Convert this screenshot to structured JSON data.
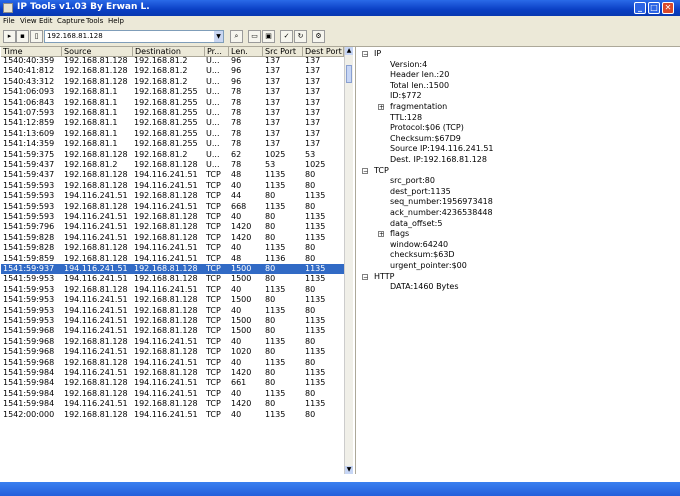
{
  "window": {
    "title": "IP Tools v1.03 By Erwan L."
  },
  "menu": [
    "File",
    "View",
    "Edit",
    "Capture",
    "Tools",
    "Help"
  ],
  "toolbar": {
    "address": "192.168.81.128"
  },
  "columns": [
    "Time",
    "Source",
    "Destination",
    "Pr...",
    "Len.",
    "Src Port",
    "Dest Port"
  ],
  "packets": [
    [
      "1540:40:359",
      "192.168.81.128",
      "192.168.81.2",
      "U...",
      "96",
      "137",
      "137"
    ],
    [
      "1540:41:812",
      "192.168.81.128",
      "192.168.81.2",
      "U...",
      "96",
      "137",
      "137"
    ],
    [
      "1540:43:312",
      "192.168.81.128",
      "192.168.81.2",
      "U...",
      "96",
      "137",
      "137"
    ],
    [
      "1541:06:093",
      "192.168.81.1",
      "192.168.81.255",
      "U...",
      "78",
      "137",
      "137"
    ],
    [
      "1541:06:843",
      "192.168.81.1",
      "192.168.81.255",
      "U...",
      "78",
      "137",
      "137"
    ],
    [
      "1541:07:593",
      "192.168.81.1",
      "192.168.81.255",
      "U...",
      "78",
      "137",
      "137"
    ],
    [
      "1541:12:859",
      "192.168.81.1",
      "192.168.81.255",
      "U...",
      "78",
      "137",
      "137"
    ],
    [
      "1541:13:609",
      "192.168.81.1",
      "192.168.81.255",
      "U...",
      "78",
      "137",
      "137"
    ],
    [
      "1541:14:359",
      "192.168.81.1",
      "192.168.81.255",
      "U...",
      "78",
      "137",
      "137"
    ],
    [
      "1541:59:375",
      "192.168.81.128",
      "192.168.81.2",
      "U...",
      "62",
      "1025",
      "53"
    ],
    [
      "1541:59:437",
      "192.168.81.2",
      "192.168.81.128",
      "U...",
      "78",
      "53",
      "1025"
    ],
    [
      "1541:59:437",
      "192.168.81.128",
      "194.116.241.51",
      "TCP",
      "48",
      "1135",
      "80"
    ],
    [
      "1541:59:593",
      "192.168.81.128",
      "194.116.241.51",
      "TCP",
      "40",
      "1135",
      "80"
    ],
    [
      "1541:59:593",
      "194.116.241.51",
      "192.168.81.128",
      "TCP",
      "44",
      "80",
      "1135"
    ],
    [
      "1541:59:593",
      "192.168.81.128",
      "194.116.241.51",
      "TCP",
      "668",
      "1135",
      "80"
    ],
    [
      "1541:59:593",
      "194.116.241.51",
      "192.168.81.128",
      "TCP",
      "40",
      "80",
      "1135"
    ],
    [
      "1541:59:796",
      "194.116.241.51",
      "192.168.81.128",
      "TCP",
      "1420",
      "80",
      "1135"
    ],
    [
      "1541:59:828",
      "194.116.241.51",
      "192.168.81.128",
      "TCP",
      "1420",
      "80",
      "1135"
    ],
    [
      "1541:59:828",
      "192.168.81.128",
      "194.116.241.51",
      "TCP",
      "40",
      "1135",
      "80"
    ],
    [
      "1541:59:859",
      "192.168.81.128",
      "194.116.241.51",
      "TCP",
      "48",
      "1136",
      "80"
    ],
    [
      "1541:59:937",
      "194.116.241.51",
      "192.168.81.128",
      "TCP",
      "1500",
      "80",
      "1135"
    ],
    [
      "1541:59:953",
      "194.116.241.51",
      "192.168.81.128",
      "TCP",
      "1500",
      "80",
      "1135"
    ],
    [
      "1541:59:953",
      "192.168.81.128",
      "194.116.241.51",
      "TCP",
      "40",
      "1135",
      "80"
    ],
    [
      "1541:59:953",
      "194.116.241.51",
      "192.168.81.128",
      "TCP",
      "1500",
      "80",
      "1135"
    ],
    [
      "1541:59:953",
      "194.116.241.51",
      "192.168.81.128",
      "TCP",
      "40",
      "1135",
      "80"
    ],
    [
      "1541:59:953",
      "194.116.241.51",
      "192.168.81.128",
      "TCP",
      "1500",
      "80",
      "1135"
    ],
    [
      "1541:59:968",
      "194.116.241.51",
      "192.168.81.128",
      "TCP",
      "1500",
      "80",
      "1135"
    ],
    [
      "1541:59:968",
      "192.168.81.128",
      "194.116.241.51",
      "TCP",
      "40",
      "1135",
      "80"
    ],
    [
      "1541:59:968",
      "194.116.241.51",
      "192.168.81.128",
      "TCP",
      "1020",
      "80",
      "1135"
    ],
    [
      "1541:59:968",
      "192.168.81.128",
      "194.116.241.51",
      "TCP",
      "40",
      "1135",
      "80"
    ],
    [
      "1541:59:984",
      "194.116.241.51",
      "192.168.81.128",
      "TCP",
      "1420",
      "80",
      "1135"
    ],
    [
      "1541:59:984",
      "192.168.81.128",
      "194.116.241.51",
      "TCP",
      "661",
      "80",
      "1135"
    ],
    [
      "1541:59:984",
      "192.168.81.128",
      "194.116.241.51",
      "TCP",
      "40",
      "1135",
      "80"
    ],
    [
      "1541:59:984",
      "194.116.241.51",
      "192.168.81.128",
      "TCP",
      "1420",
      "80",
      "1135"
    ],
    [
      "1542:00:000",
      "192.168.81.128",
      "194.116.241.51",
      "TCP",
      "40",
      "1135",
      "80"
    ]
  ],
  "selected_row": 20,
  "tree": [
    {
      "level": 0,
      "text": "IP",
      "expander": "minus"
    },
    {
      "level": 1,
      "text": "Version:4"
    },
    {
      "level": 1,
      "text": "Header len.:20"
    },
    {
      "level": 1,
      "text": "Total len.:1500"
    },
    {
      "level": 1,
      "text": "ID:$772"
    },
    {
      "level": 1,
      "text": "fragmentation",
      "expander": "plus"
    },
    {
      "level": 1,
      "text": "TTL:128"
    },
    {
      "level": 1,
      "text": "Protocol:$06 (TCP)"
    },
    {
      "level": 1,
      "text": "Checksum:$67D9"
    },
    {
      "level": 1,
      "text": "Source IP:194.116.241.51"
    },
    {
      "level": 1,
      "text": "Dest. IP:192.168.81.128"
    },
    {
      "level": 0,
      "text": "TCP",
      "expander": "minus"
    },
    {
      "level": 1,
      "text": "src_port:80"
    },
    {
      "level": 1,
      "text": "dest_port:1135"
    },
    {
      "level": 1,
      "text": "seq_number:1956973418"
    },
    {
      "level": 1,
      "text": "ack_number:4236538448"
    },
    {
      "level": 1,
      "text": "data_offset:5"
    },
    {
      "level": 1,
      "text": "flags",
      "expander": "plus"
    },
    {
      "level": 1,
      "text": "window:64240"
    },
    {
      "level": 1,
      "text": "checksum:$63D"
    },
    {
      "level": 1,
      "text": "urgent_pointer:$00"
    },
    {
      "level": 0,
      "text": "HTTP",
      "expander": "minus"
    },
    {
      "level": 1,
      "text": "DATA:1460 Bytes"
    }
  ]
}
